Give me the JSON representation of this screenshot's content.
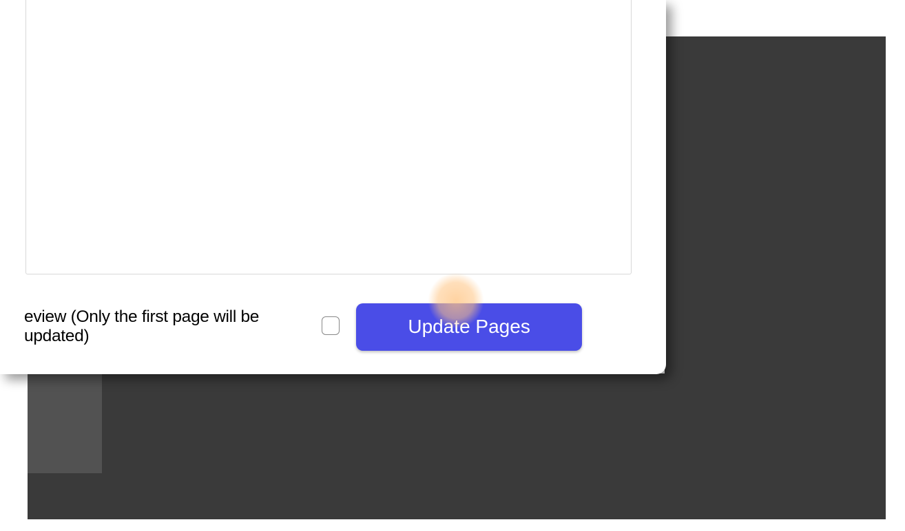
{
  "controls": {
    "preview_label": "eview (Only the first page will be updated)",
    "update_button_label": "Update Pages"
  }
}
